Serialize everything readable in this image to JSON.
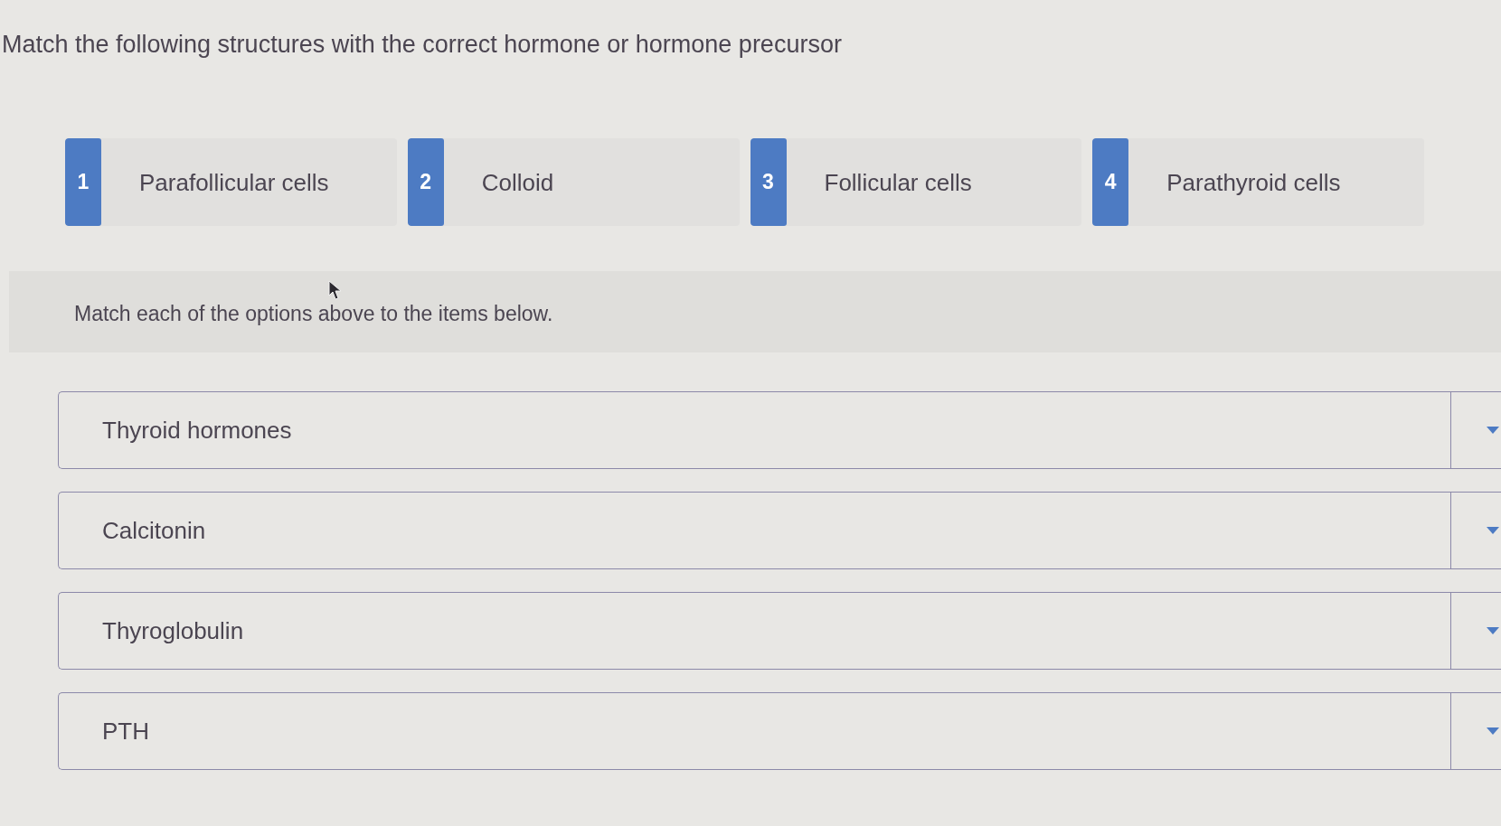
{
  "prompt": {
    "text": "Match the following structures with the correct hormone or hormone precursor"
  },
  "options": [
    {
      "number": "1",
      "label": "Parafollicular cells"
    },
    {
      "number": "2",
      "label": "Colloid"
    },
    {
      "number": "3",
      "label": "Follicular cells"
    },
    {
      "number": "4",
      "label": "Parathyroid cells"
    }
  ],
  "instruction": {
    "text": "Match each of the options above to the items below."
  },
  "items": [
    {
      "label": "Thyroid hormones"
    },
    {
      "label": "Calcitonin"
    },
    {
      "label": "Thyroglobulin"
    },
    {
      "label": "PTH"
    }
  ]
}
